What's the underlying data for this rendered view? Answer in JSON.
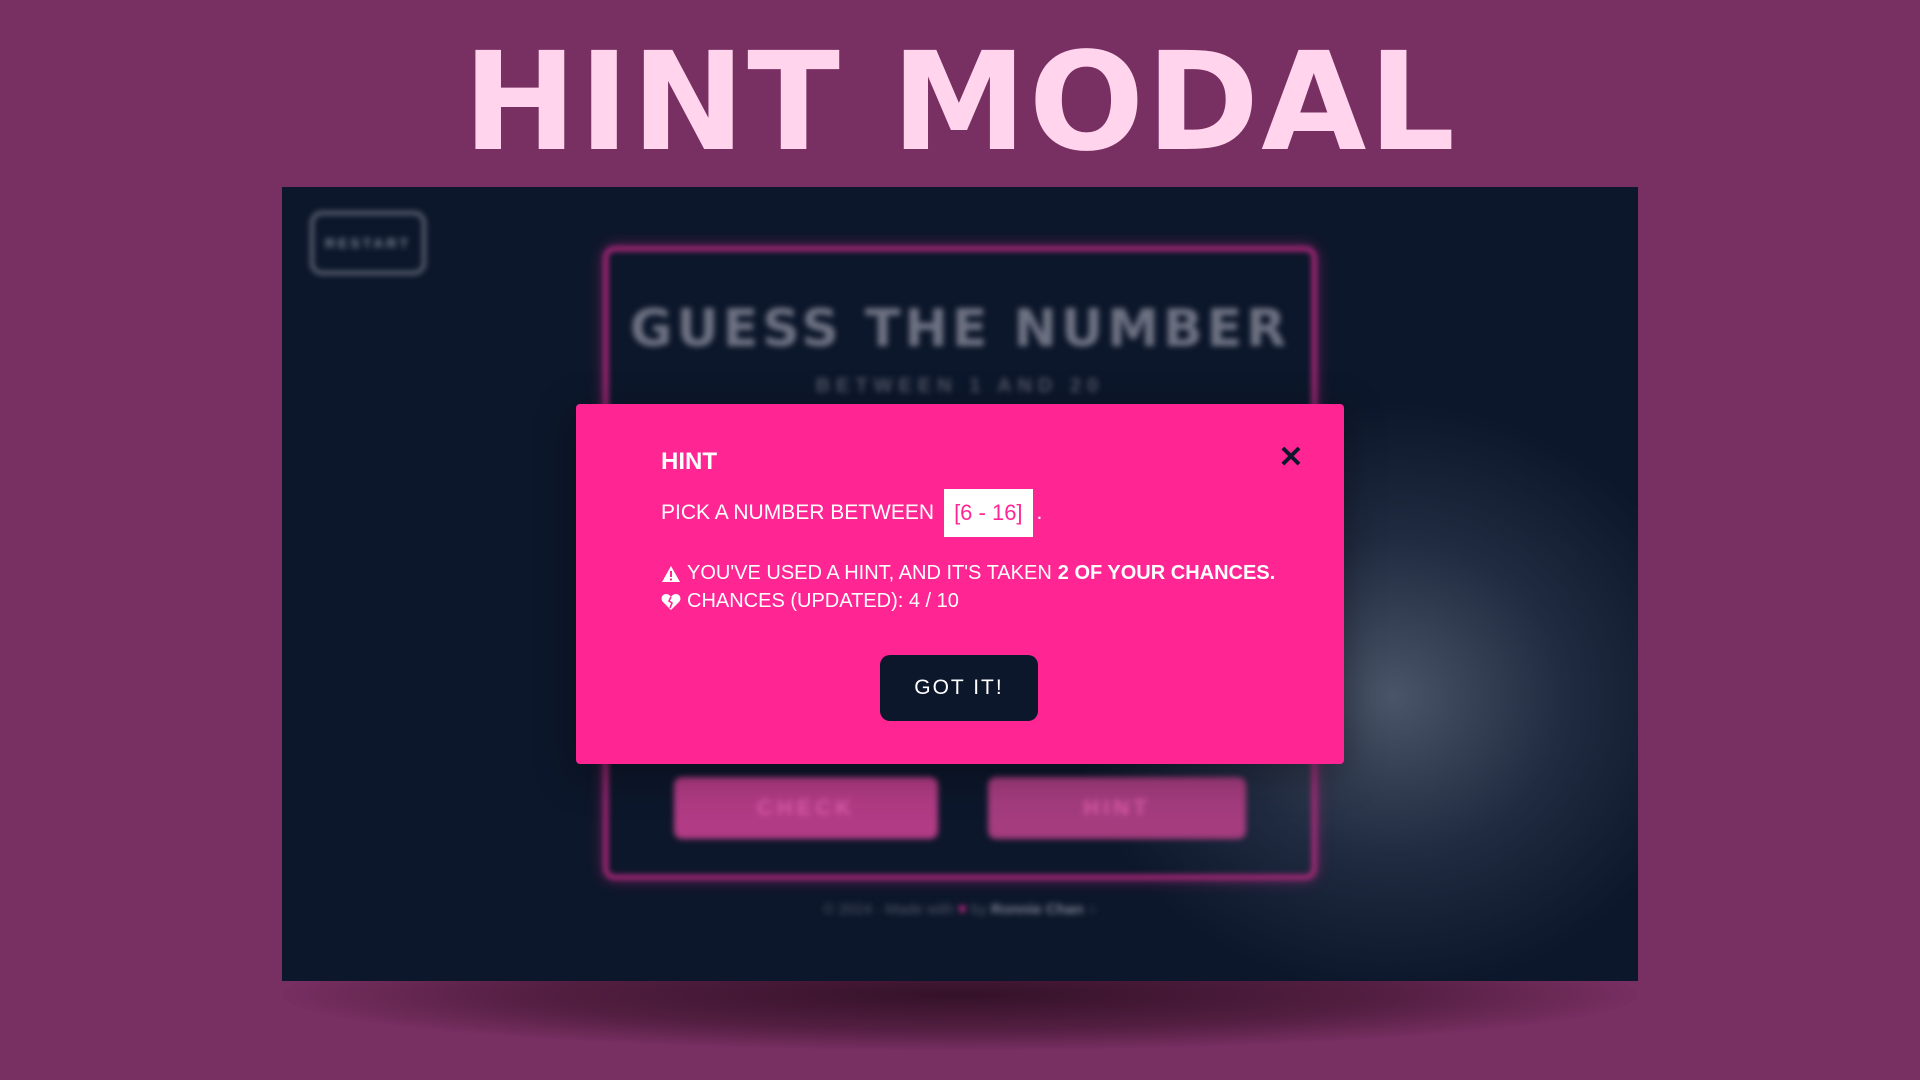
{
  "headline": "HINT MODAL",
  "background_app": {
    "restart_label": "RESTART",
    "title": "GUESS THE NUMBER",
    "subtitle": "BETWEEN 1 AND 20",
    "check_label": "CHECK",
    "hint_label": "HINT",
    "footer": {
      "prefix": "© 2024 · Made with",
      "heart": "♥",
      "by": "by",
      "author": "Ronnie Chan"
    }
  },
  "modal": {
    "title": "HINT",
    "close_icon": "close-icon",
    "pick_prefix": "PICK A NUMBER BETWEEN",
    "range": "[6 - 16]",
    "pick_suffix": ".",
    "warning_icon": "warning-icon",
    "warning_text": "YOU'VE USED A HINT, AND IT'S TAKEN",
    "warning_bold": "2 OF YOUR CHANCES.",
    "heart_icon": "broken-heart-icon",
    "chances_text": "CHANCES (UPDATED): 4 / 10",
    "confirm_label": "GOT IT!"
  },
  "colors": {
    "page_bg": "#782f62",
    "headline": "#ffd4ec",
    "screen_bg": "#0d172b",
    "modal_bg": "#ff2694",
    "accent": "#c72a87"
  }
}
